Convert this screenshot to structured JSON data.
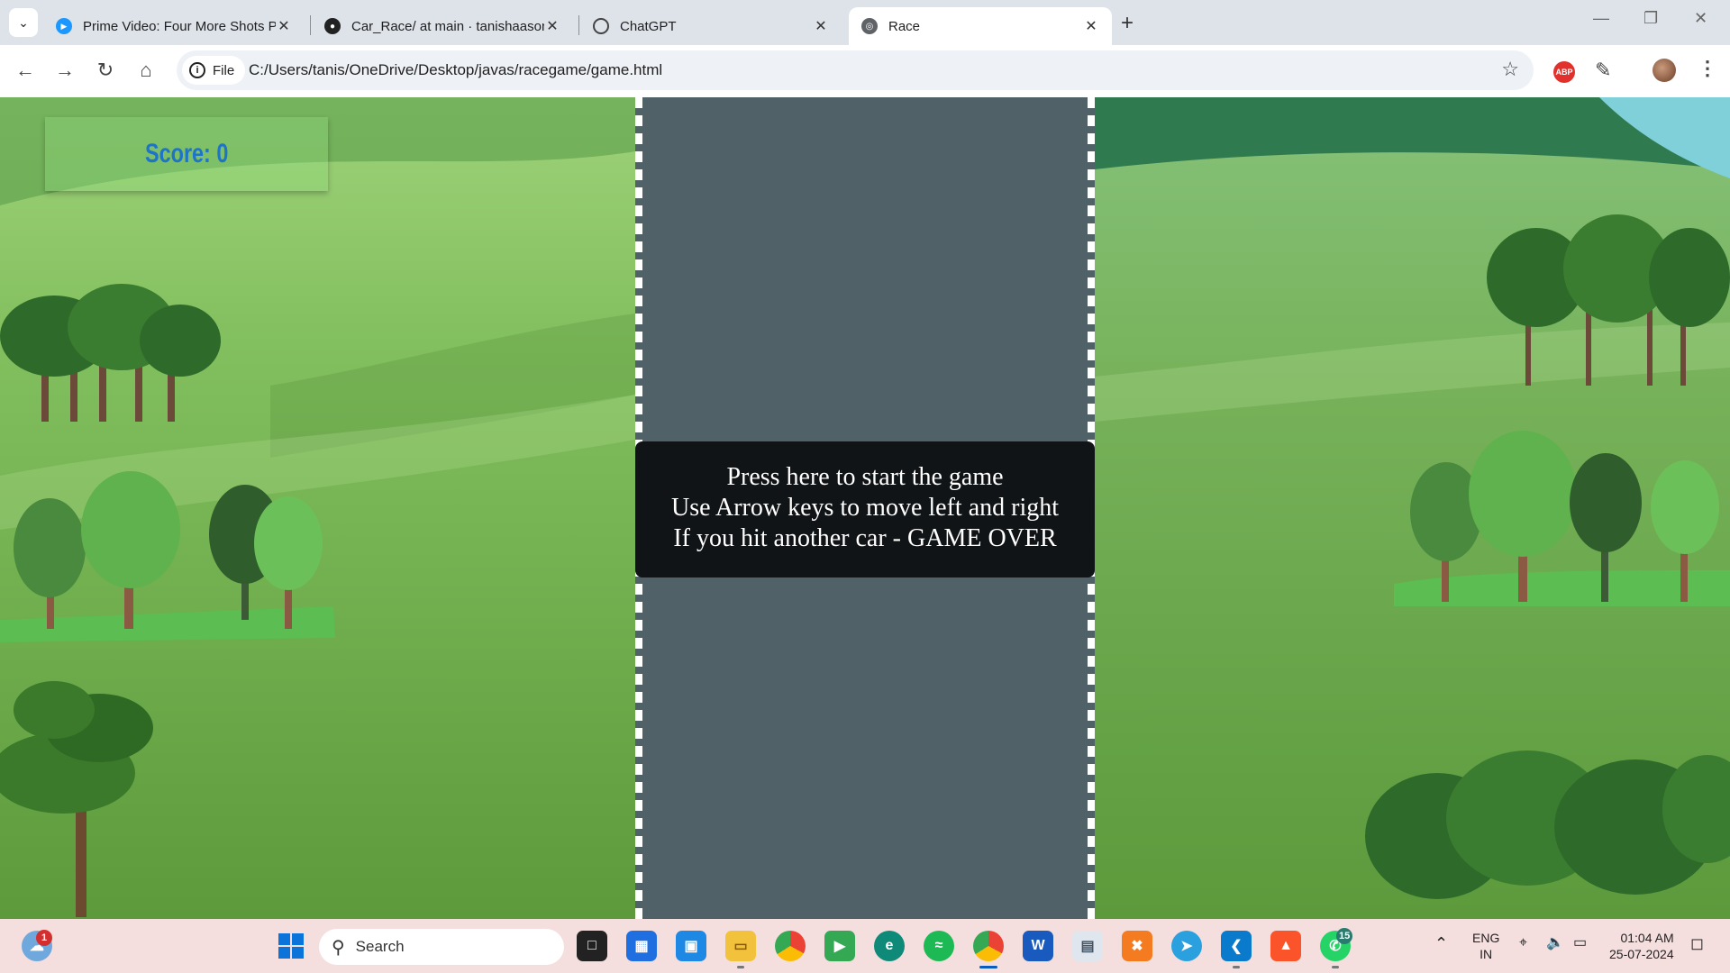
{
  "browser": {
    "tabs": [
      {
        "title": "Prime Video: Four More Shots P",
        "active": false
      },
      {
        "title": "Car_Race/ at main · tanishaason",
        "active": false
      },
      {
        "title": "ChatGPT",
        "active": false
      },
      {
        "title": "Race",
        "active": true
      }
    ],
    "chip_label": "File",
    "url": "C:/Users/tanis/OneDrive/Desktop/javas/racegame/game.html",
    "abp_label": "ABP"
  },
  "game": {
    "score_text": "Score: 0",
    "instructions": [
      "Press here to start the game",
      "Use Arrow keys to move left and right",
      "If you hit another car - GAME OVER"
    ],
    "colors": {
      "road": "#506168",
      "score": "#1e74c8",
      "overlay": "#111416"
    }
  },
  "taskbar": {
    "search_placeholder": "Search",
    "weather_badge": "1",
    "whatsapp_badge": "15",
    "lang_top": "ENG",
    "lang_bottom": "IN",
    "time": "01:04 AM",
    "date": "25-07-2024"
  }
}
